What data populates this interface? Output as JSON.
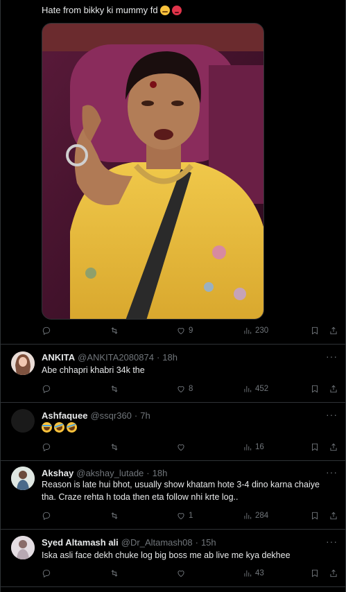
{
  "main_tweet": {
    "text": "Hate from bikky ki mummy fd",
    "emojis": [
      "thinking-face",
      "angry-face"
    ],
    "stats": {
      "replies": "",
      "retweets": "",
      "likes": "9",
      "views": "230"
    }
  },
  "replies": [
    {
      "name": "ANKITA",
      "handle": "@ANKITA2080874",
      "sep": "·",
      "time": "18h",
      "text": "Abe chhapri khabri 34k the",
      "stats": {
        "replies": "",
        "retweets": "",
        "likes": "8",
        "views": "452"
      }
    },
    {
      "name": "Ashfaquee",
      "handle": "@ssqr360",
      "sep": "·",
      "time": "7h",
      "text": "",
      "emojis": [
        "laughing-tears",
        "rofl",
        "rofl"
      ],
      "stats": {
        "replies": "",
        "retweets": "",
        "likes": "",
        "views": "16"
      }
    },
    {
      "name": "Akshay",
      "handle": "@akshay_lutade",
      "sep": "·",
      "time": "18h",
      "text": "Reason is late hui bhot, usually show khatam hote 3-4 dino karna chaiye tha. Craze rehta h toda then eta follow nhi krte log..",
      "stats": {
        "replies": "",
        "retweets": "",
        "likes": "1",
        "views": "284"
      }
    },
    {
      "name": "Syed Altamash ali",
      "handle": "@Dr_Altamash08",
      "sep": "·",
      "time": "15h",
      "text": "Iska asli face dekh chuke log big boss me ab live me kya dekhee",
      "stats": {
        "replies": "",
        "retweets": "",
        "likes": "",
        "views": "43"
      }
    }
  ],
  "icons": {
    "reply": "reply-icon",
    "retweet": "retweet-icon",
    "like": "heart-icon",
    "views": "views-chart-icon",
    "bookmark": "bookmark-icon",
    "share": "share-icon",
    "more": "more-icon"
  },
  "more_label": "···",
  "colors": {
    "background": "#000000",
    "text": "#e7e9ea",
    "muted": "#71767b",
    "border": "#2f3336"
  }
}
